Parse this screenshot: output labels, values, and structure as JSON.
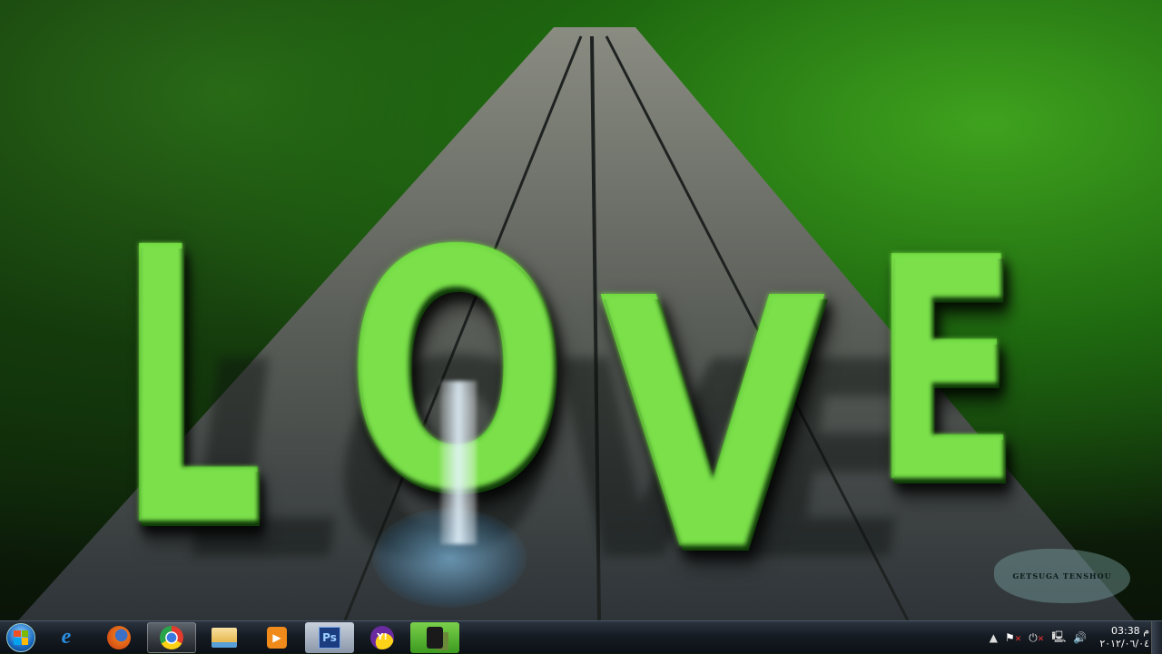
{
  "wallpaper": {
    "text": "LOVE",
    "letters": [
      "L",
      "O",
      "V",
      "E"
    ],
    "watermark": "GETSUGA TENSHOU"
  },
  "taskbar": {
    "start_label": "Start",
    "pinned": [
      {
        "name": "internet-explorer",
        "icon": "ie-icon",
        "glyph": "e",
        "color": "#2a8ee0"
      },
      {
        "name": "firefox",
        "icon": "firefox-icon",
        "glyph": "●",
        "color": "#e8701a"
      },
      {
        "name": "chrome",
        "icon": "chrome-icon",
        "glyph": "◉",
        "color": "#e33b2e"
      },
      {
        "name": "windows-explorer",
        "icon": "folder-icon",
        "glyph": "▬",
        "color": "#f0c860"
      },
      {
        "name": "media-player",
        "icon": "media-player-icon",
        "glyph": "▶",
        "color": "#f08a1a"
      },
      {
        "name": "photoshop",
        "icon": "photoshop-icon",
        "glyph": "Ps",
        "color": "#1c3c80"
      },
      {
        "name": "yahoo-messenger",
        "icon": "yahoo-messenger-icon",
        "glyph": "Y!",
        "color": "#6a2aa0"
      },
      {
        "name": "video-camera-app",
        "icon": "camcorder-icon",
        "glyph": "■",
        "color": "#1a1a1a"
      }
    ]
  },
  "tray": {
    "time": "03:38 م",
    "date": "٢٠١٢/٠٦/٠٤"
  }
}
